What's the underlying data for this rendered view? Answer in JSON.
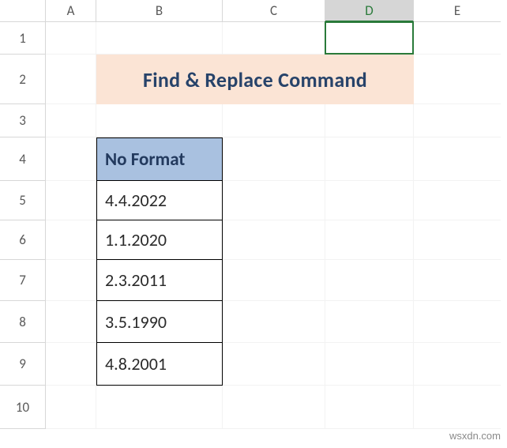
{
  "columns": [
    "A",
    "B",
    "C",
    "D",
    "E"
  ],
  "rows": [
    "1",
    "2",
    "3",
    "4",
    "5",
    "6",
    "7",
    "8",
    "9",
    "10"
  ],
  "active_cell": "D1",
  "title": "Find & Replace Command",
  "table": {
    "header": "No Format",
    "values": [
      "4.4.2022",
      "1.1.2020",
      "2.3.2011",
      "3.5.1990",
      "4.8.2001"
    ]
  },
  "watermark": "wsxdn.com",
  "colors": {
    "title_bg": "#fbe4d5",
    "title_fg": "#27436a",
    "th_bg": "#a9c1e0",
    "active": "#2a7a3a"
  }
}
